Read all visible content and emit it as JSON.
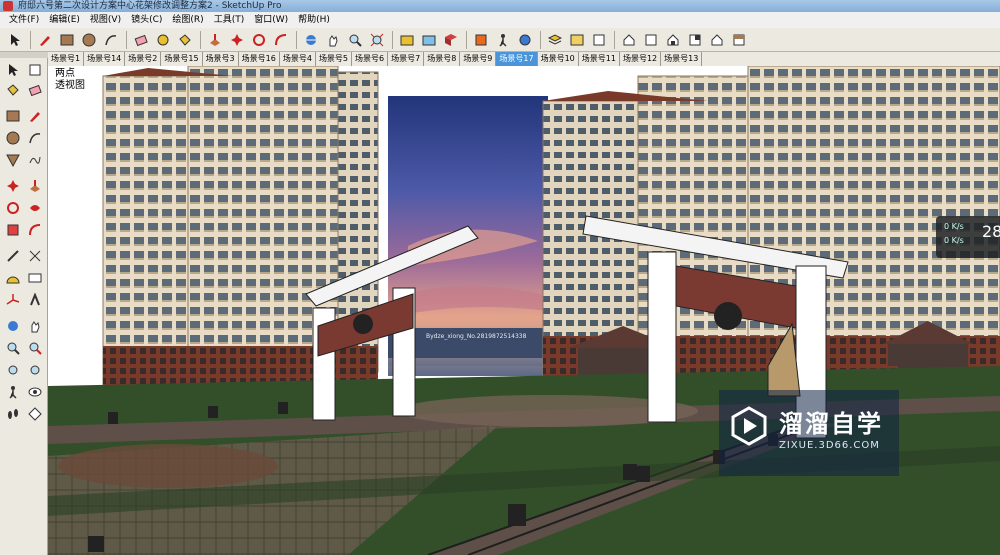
{
  "window": {
    "title": "府邸六号第二次设计方案中心花架修改调整方案2 - SketchUp Pro"
  },
  "menu": [
    "文件(F)",
    "编辑(E)",
    "视图(V)",
    "镜头(C)",
    "绘图(R)",
    "工具(T)",
    "窗口(W)",
    "帮助(H)"
  ],
  "scene_tabs": [
    "场景号1",
    "场景号14",
    "场景号2",
    "场景号15",
    "场景号3",
    "场景号16",
    "场景号4",
    "场景号5",
    "场景号6",
    "场景号7",
    "场景号8",
    "场景号9",
    "场景号17",
    "场景号10",
    "场景号11",
    "场景号12",
    "场景号13"
  ],
  "active_scene": "场景号17",
  "viewport": {
    "camera_mode": "两点",
    "view_name": "透视图",
    "sky_caption": "Bydze_xiong_No.2819872514338",
    "hud": {
      "line1": "0 K/s",
      "line2": "0 K/s",
      "value": "28"
    }
  },
  "watermark": {
    "name": "溜溜自学",
    "url": "ZIXUE.3D66.COM"
  },
  "colors": {
    "sky_top": "#2a3e8a",
    "sky_mid": "#9c6a9a",
    "sky_horizon": "#e8a78a",
    "grass": "#334f2a",
    "building": "#e8dcc6",
    "scene_active": "#4a94da"
  }
}
